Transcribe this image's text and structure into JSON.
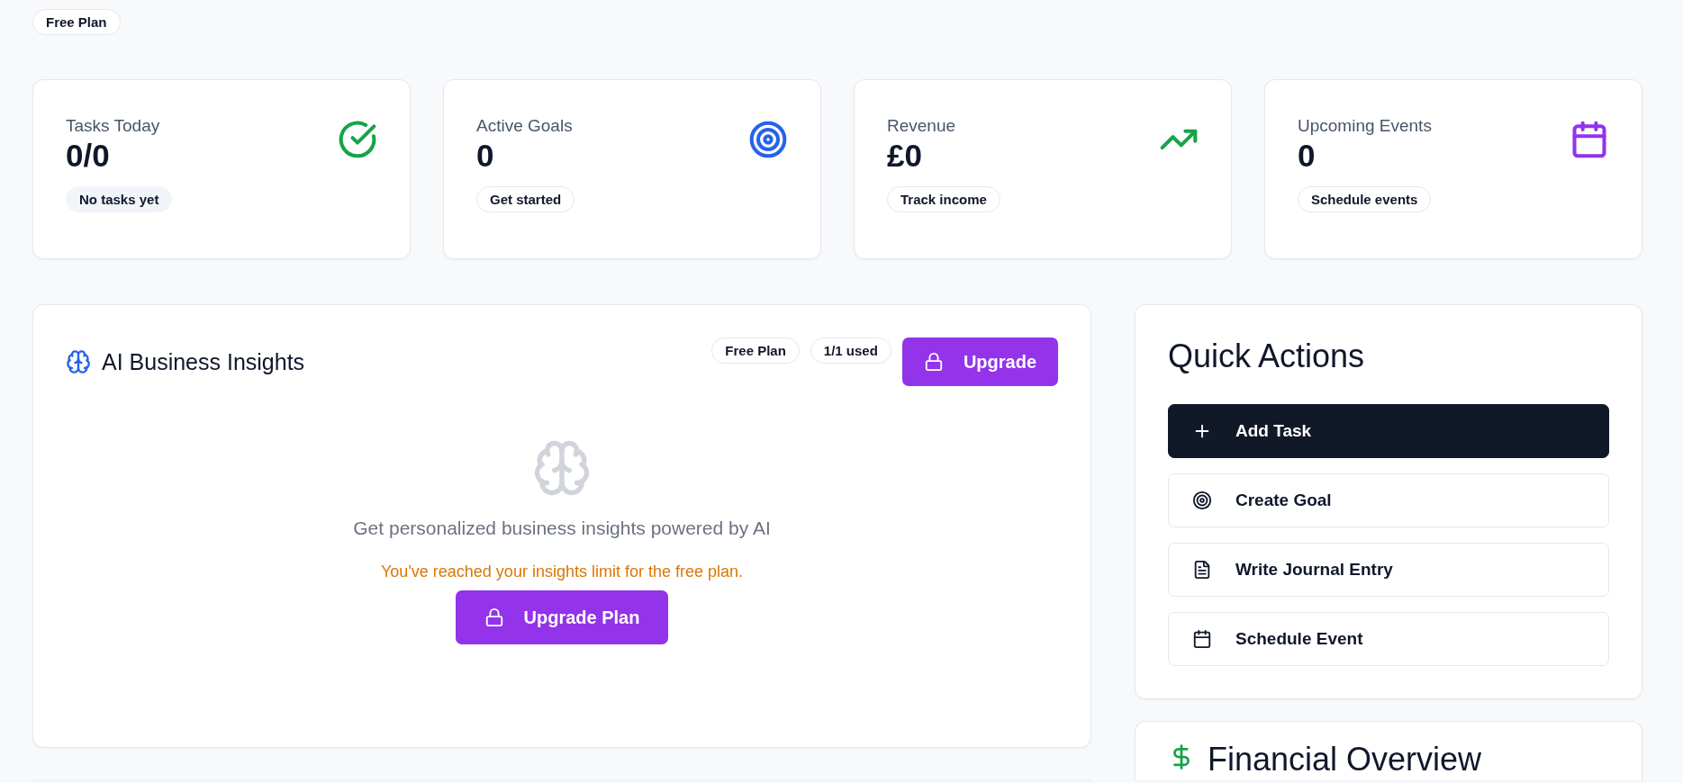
{
  "plan_badge": "Free Plan",
  "stats": [
    {
      "title": "Tasks Today",
      "value": "0/0",
      "note": "No tasks yet",
      "note_filled": true,
      "kind": "check",
      "color": "#16a34a"
    },
    {
      "title": "Active Goals",
      "value": "0",
      "note": "Get started",
      "note_filled": false,
      "kind": "target",
      "color": "#2563eb"
    },
    {
      "title": "Revenue",
      "value": "£0",
      "note": "Track income",
      "note_filled": false,
      "kind": "trend",
      "color": "#16a34a"
    },
    {
      "title": "Upcoming Events",
      "value": "0",
      "note": "Schedule events",
      "note_filled": false,
      "kind": "calendar",
      "color": "#9333ea"
    }
  ],
  "insights": {
    "title": "AI Business Insights",
    "badges": [
      "Free Plan",
      "1/1 used"
    ],
    "upgrade_button": "Upgrade",
    "message": "Get personalized business insights powered by AI",
    "limit_message": "You've reached your insights limit for the free plan.",
    "upgrade_plan_button": "Upgrade Plan"
  },
  "quick_actions": {
    "title": "Quick Actions",
    "actions": [
      {
        "label": "Add Task",
        "kind": "plus",
        "primary": true
      },
      {
        "label": "Create Goal",
        "kind": "target",
        "primary": false
      },
      {
        "label": "Write Journal Entry",
        "kind": "file",
        "primary": false
      },
      {
        "label": "Schedule Event",
        "kind": "calendar",
        "primary": false
      }
    ]
  },
  "financial_overview": {
    "title": "Financial Overview"
  }
}
